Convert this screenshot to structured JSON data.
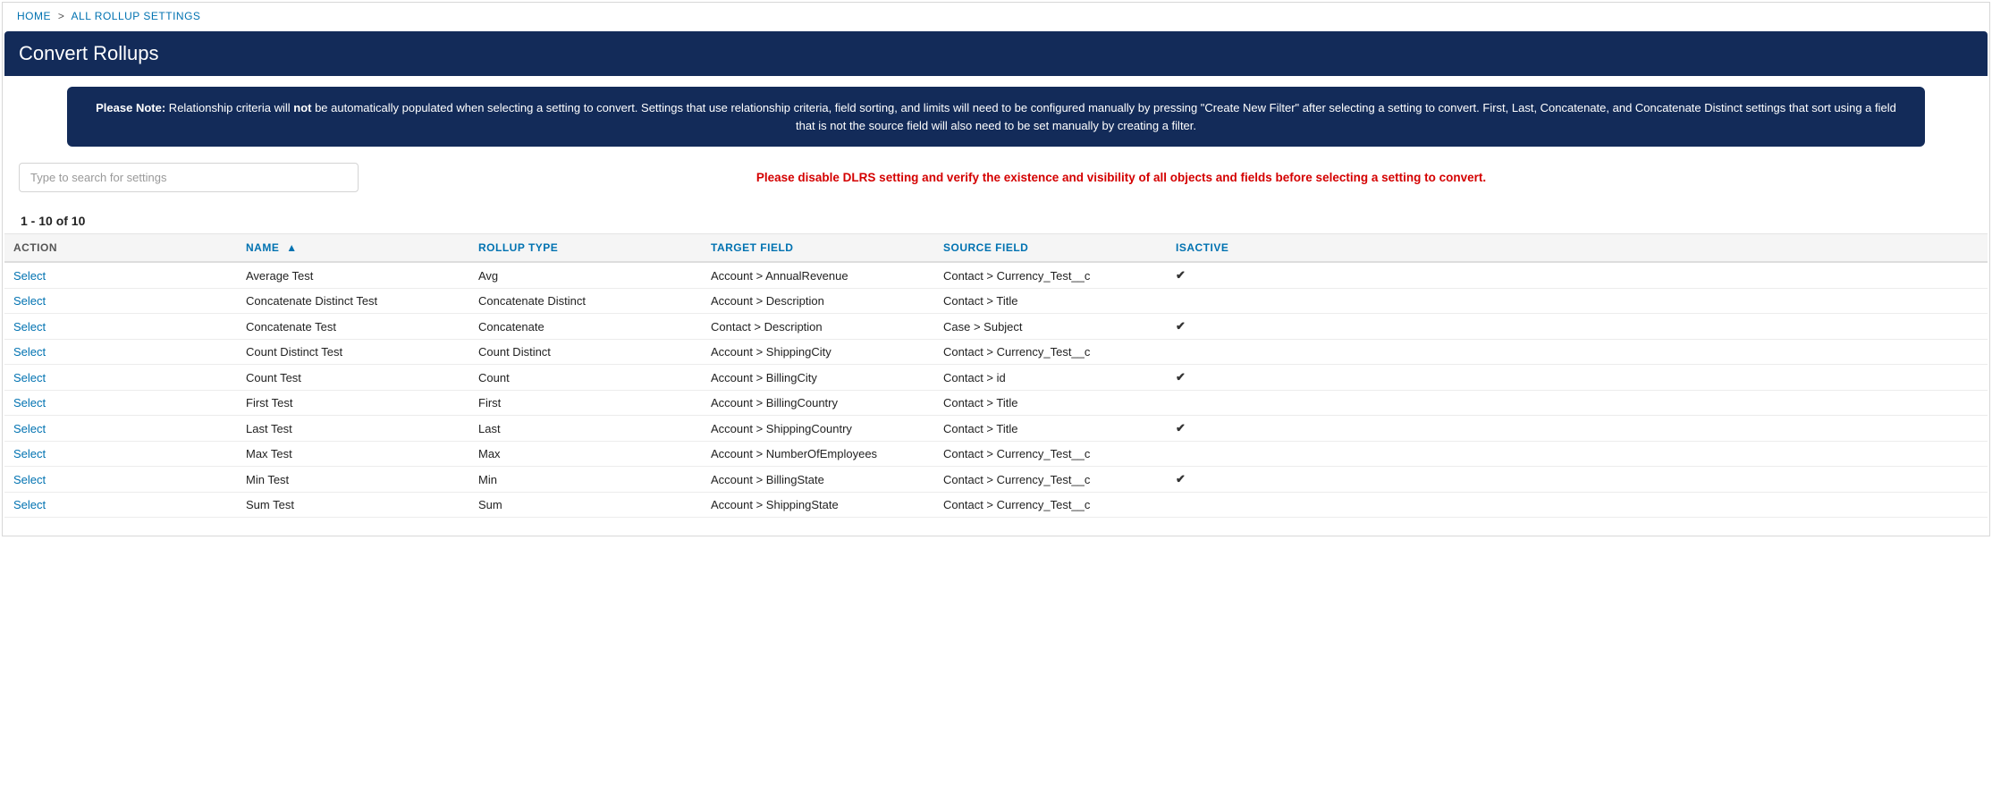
{
  "breadcrumb": {
    "home": "HOME",
    "current": "ALL ROLLUP SETTINGS"
  },
  "page_title": "Convert Rollups",
  "note": {
    "prefix_bold": "Please Note:",
    "text_before_not": " Relationship criteria will ",
    "not_bold": "not",
    "text_after_not": " be automatically populated when selecting a setting to convert. Settings that use relationship criteria, field sorting, and limits will need to be configured manually by pressing \"Create New Filter\" after selecting a setting to convert. First, Last, Concatenate, and Concatenate Distinct settings that sort using a field that is not the source field will also need to be set manually by creating a filter."
  },
  "search": {
    "placeholder": "Type to search for settings"
  },
  "warn": "Please disable DLRS setting and verify the existence and visibility of all objects and fields before selecting a setting to convert.",
  "pager": "1 - 10 of 10",
  "columns": {
    "action": "ACTION",
    "name": "NAME",
    "name_sort": "▲",
    "rollup_type": "ROLLUP TYPE",
    "target_field": "TARGET FIELD",
    "source_field": "SOURCE FIELD",
    "isactive": "ISACTIVE"
  },
  "action_label": "Select",
  "check_glyph": "✔",
  "rows": [
    {
      "name": "Average Test",
      "type": "Avg",
      "target": "Account > AnnualRevenue",
      "source": "Contact > Currency_Test__c",
      "active": true
    },
    {
      "name": "Concatenate Distinct Test",
      "type": "Concatenate Distinct",
      "target": "Account > Description",
      "source": "Contact > Title",
      "active": false
    },
    {
      "name": "Concatenate Test",
      "type": "Concatenate",
      "target": "Contact > Description",
      "source": "Case > Subject",
      "active": true
    },
    {
      "name": "Count Distinct Test",
      "type": "Count Distinct",
      "target": "Account > ShippingCity",
      "source": "Contact > Currency_Test__c",
      "active": false
    },
    {
      "name": "Count Test",
      "type": "Count",
      "target": "Account > BillingCity",
      "source": "Contact > id",
      "active": true
    },
    {
      "name": "First Test",
      "type": "First",
      "target": "Account > BillingCountry",
      "source": "Contact > Title",
      "active": false
    },
    {
      "name": "Last Test",
      "type": "Last",
      "target": "Account > ShippingCountry",
      "source": "Contact > Title",
      "active": true
    },
    {
      "name": "Max Test",
      "type": "Max",
      "target": "Account > NumberOfEmployees",
      "source": "Contact > Currency_Test__c",
      "active": false
    },
    {
      "name": "Min Test",
      "type": "Min",
      "target": "Account > BillingState",
      "source": "Contact > Currency_Test__c",
      "active": true
    },
    {
      "name": "Sum Test",
      "type": "Sum",
      "target": "Account > ShippingState",
      "source": "Contact > Currency_Test__c",
      "active": false
    }
  ]
}
